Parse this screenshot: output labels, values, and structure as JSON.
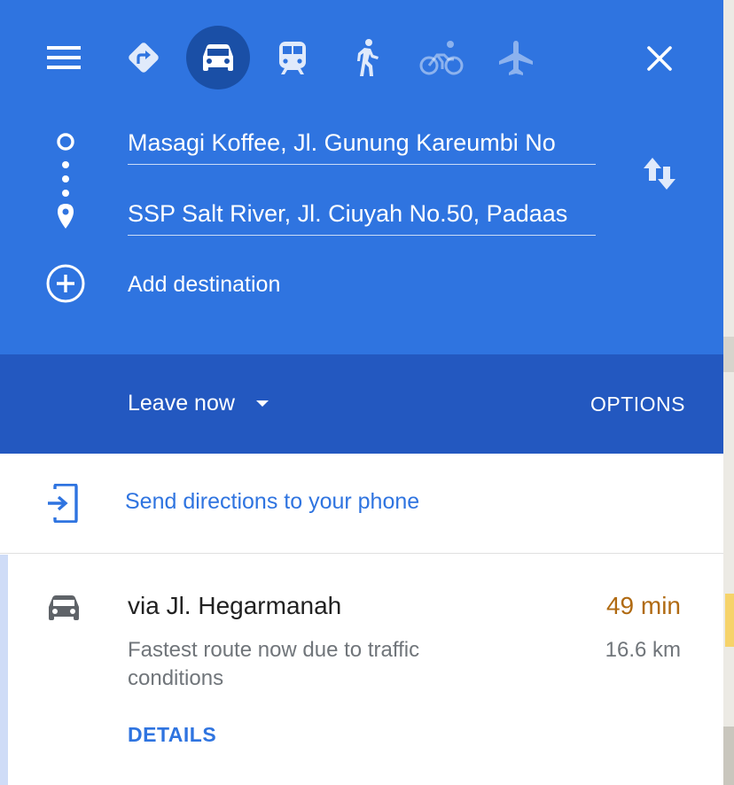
{
  "modes": {
    "menu_icon": "menu-icon",
    "items": [
      {
        "name": "best-route",
        "icon": "directions-diamond-icon",
        "active": false,
        "enabled": true
      },
      {
        "name": "driving",
        "icon": "car-icon",
        "active": true,
        "enabled": true
      },
      {
        "name": "transit",
        "icon": "train-icon",
        "active": false,
        "enabled": true
      },
      {
        "name": "walking",
        "icon": "walk-icon",
        "active": false,
        "enabled": true
      },
      {
        "name": "cycling",
        "icon": "bicycle-icon",
        "active": false,
        "enabled": false
      },
      {
        "name": "flights",
        "icon": "airplane-icon",
        "active": false,
        "enabled": false
      }
    ],
    "close_icon": "close-icon"
  },
  "route_inputs": {
    "origin": "Masagi Koffee, Jl. Gunung Kareumbi No",
    "destination": "SSP Salt River, Jl. Ciuyah No.50, Padaas",
    "add_destination": "Add destination",
    "swap_icon": "swap-icon"
  },
  "departure": {
    "label": "Leave now",
    "options": "OPTIONS"
  },
  "send": {
    "label": "Send directions to your phone",
    "icon": "send-to-phone-icon"
  },
  "route": {
    "title": "via Jl. Hegarmanah",
    "time": "49 min",
    "description": "Fastest route now due to traffic conditions",
    "distance": "16.6 km",
    "details": "DETAILS"
  },
  "colors": {
    "header": "#2f74e0",
    "header_dark": "#2358c0",
    "active_mode": "#1a4fa6",
    "link": "#2f74e0",
    "traffic_time": "#b06a12"
  }
}
